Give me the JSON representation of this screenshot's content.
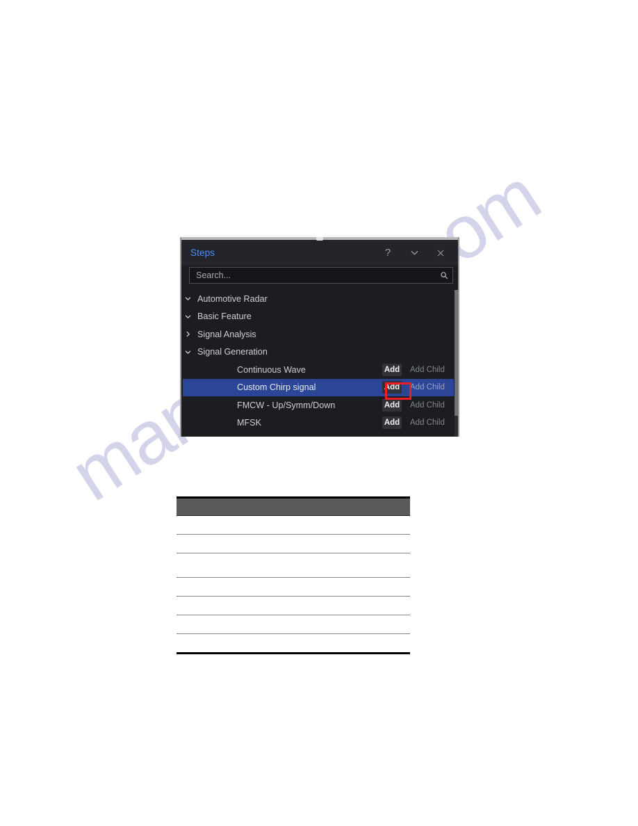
{
  "watermark": {
    "text": "manualslive.com",
    "color": "#3b3f9e"
  },
  "panel": {
    "title": "Steps",
    "title_color": "#4a8ff7",
    "titlebar_buttons": [
      {
        "name": "help-icon",
        "label": "?"
      },
      {
        "name": "chevron-down-icon",
        "label": ""
      },
      {
        "name": "close-icon",
        "label": ""
      }
    ],
    "search": {
      "placeholder": "Search...",
      "value": "",
      "icon": "search-icon"
    },
    "selection_color": "#2b4697",
    "annotation_color": "#ee1c25",
    "tree": [
      {
        "label": "Automotive Radar",
        "depth": 0,
        "type": "group",
        "expanded": true,
        "twisty": "chevron-down-icon",
        "selected": false
      },
      {
        "label": "Basic Feature",
        "depth": 1,
        "type": "group",
        "expanded": true,
        "twisty": "chevron-down-icon",
        "selected": false
      },
      {
        "label": "Signal Analysis",
        "depth": 2,
        "type": "group",
        "expanded": false,
        "twisty": "chevron-right-icon",
        "selected": false
      },
      {
        "label": "Signal Generation",
        "depth": 2,
        "type": "group",
        "expanded": true,
        "twisty": "chevron-down-icon",
        "selected": false
      },
      {
        "label": "Continuous Wave",
        "depth": 3,
        "type": "leaf",
        "selected": false,
        "add_label": "Add",
        "add_child_label": "Add Child",
        "add_child_disabled": true,
        "annotated": false
      },
      {
        "label": "Custom Chirp signal",
        "depth": 3,
        "type": "leaf",
        "selected": true,
        "add_label": "Add",
        "add_child_label": "Add Child",
        "add_child_disabled": true,
        "annotated": true
      },
      {
        "label": "FMCW - Up/Symm/Down",
        "depth": 3,
        "type": "leaf",
        "selected": false,
        "add_label": "Add",
        "add_child_label": "Add Child",
        "add_child_disabled": true,
        "annotated": false
      },
      {
        "label": "MFSK",
        "depth": 3,
        "type": "leaf",
        "selected": false,
        "add_label": "Add",
        "add_child_label": "Add Child",
        "add_child_disabled": true,
        "annotated": false
      }
    ]
  },
  "document_table": {
    "header_color": "#58595b",
    "header_cells": [
      ""
    ],
    "rows": [
      [
        ""
      ],
      [
        ""
      ],
      [
        ""
      ],
      [
        ""
      ],
      [
        ""
      ],
      [
        ""
      ],
      [
        ""
      ]
    ]
  }
}
